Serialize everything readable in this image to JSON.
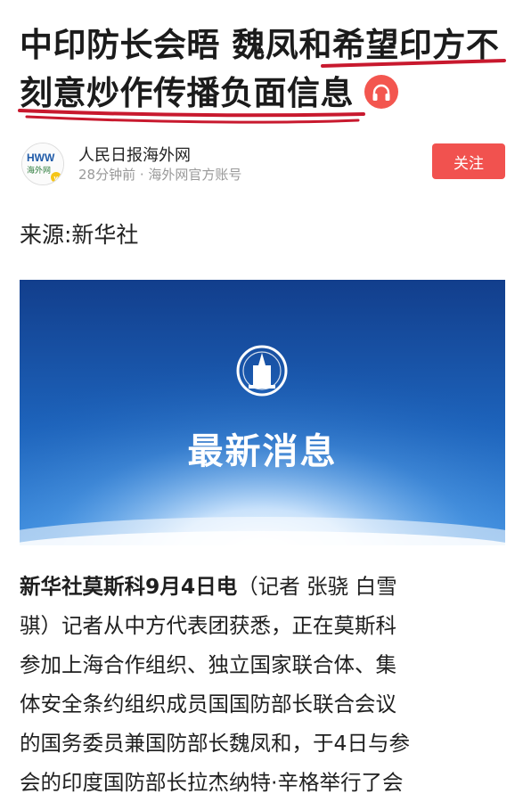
{
  "headline": {
    "line1": "中印防长会晤 魏凤和希望印方不",
    "line2": "刻意炒作传播负面信息"
  },
  "author": {
    "logo_text": "HWW",
    "logo_sub": "海外网",
    "name": "人民日报海外网",
    "meta": "28分钟前 · 海外网官方账号",
    "follow_label": "关注"
  },
  "source": "来源:新华社",
  "banner": {
    "text": "最新消息"
  },
  "article": {
    "dateline": "新华社莫斯科9月4日电",
    "line1_rest": "（记者 张骁 白雪",
    "line2": "骐）记者从中方代表团获悉，正在莫斯科",
    "line3": "参加上海合作组织、独立国家联合体、集",
    "line4": "体安全条约组织成员国国防部长联合会议",
    "line5": "的国务委员兼国防部长魏凤和，于4日与参",
    "line6": "会的印度国防部长拉杰纳特·辛格举行了会"
  },
  "colors": {
    "accent_red": "#f1524f",
    "underline_red": "#c8192e",
    "banner_blue": "#1d5fb4"
  }
}
